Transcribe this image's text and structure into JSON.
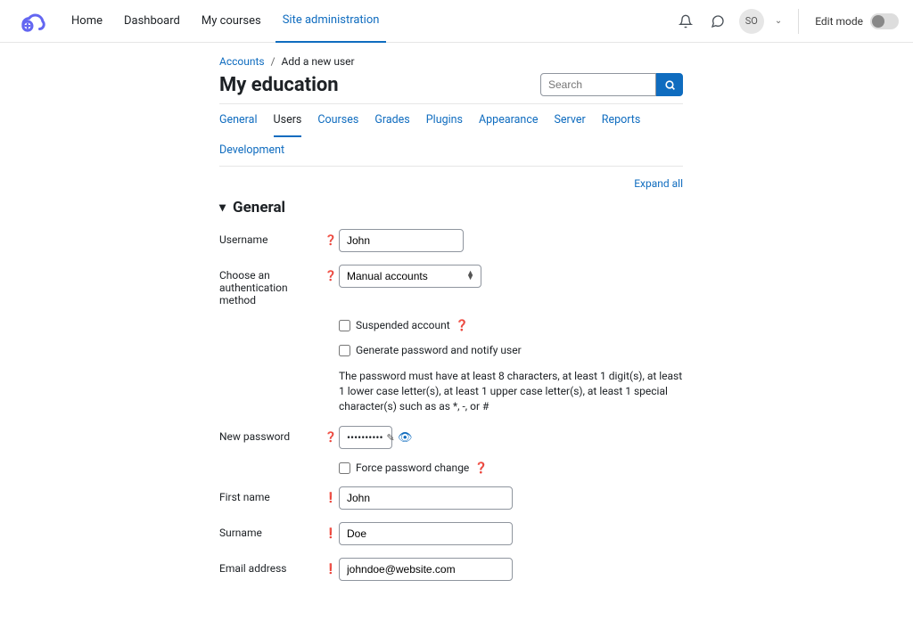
{
  "nav": {
    "home": "Home",
    "dashboard": "Dashboard",
    "mycourses": "My courses",
    "siteadmin": "Site administration"
  },
  "user": {
    "initials": "SO",
    "edit_mode_label": "Edit mode"
  },
  "breadcrumb": {
    "accounts": "Accounts",
    "add_user": "Add a new user"
  },
  "page_title": "My education",
  "search": {
    "placeholder": "Search"
  },
  "tabs": {
    "general": "General",
    "users": "Users",
    "courses": "Courses",
    "grades": "Grades",
    "plugins": "Plugins",
    "appearance": "Appearance",
    "server": "Server",
    "reports": "Reports",
    "development": "Development"
  },
  "expand_all": "Expand all",
  "section_general": "General",
  "form": {
    "username_label": "Username",
    "username_value": "John",
    "auth_label": "Choose an authentication method",
    "auth_value": "Manual accounts",
    "suspended_label": "Suspended account",
    "generate_pwd_label": "Generate password and notify user",
    "pwd_rules": "The password must have at least 8 characters, at least 1 digit(s), at least 1 lower case letter(s), at least 1 upper case letter(s), at least 1 special character(s) such as as *, -, or #",
    "new_pwd_label": "New password",
    "new_pwd_value": "••••••••••",
    "force_change_label": "Force password change",
    "firstname_label": "First name",
    "firstname_value": "John",
    "surname_label": "Surname",
    "surname_value": "Doe",
    "email_label": "Email address",
    "email_value": "johndoe@website.com"
  }
}
